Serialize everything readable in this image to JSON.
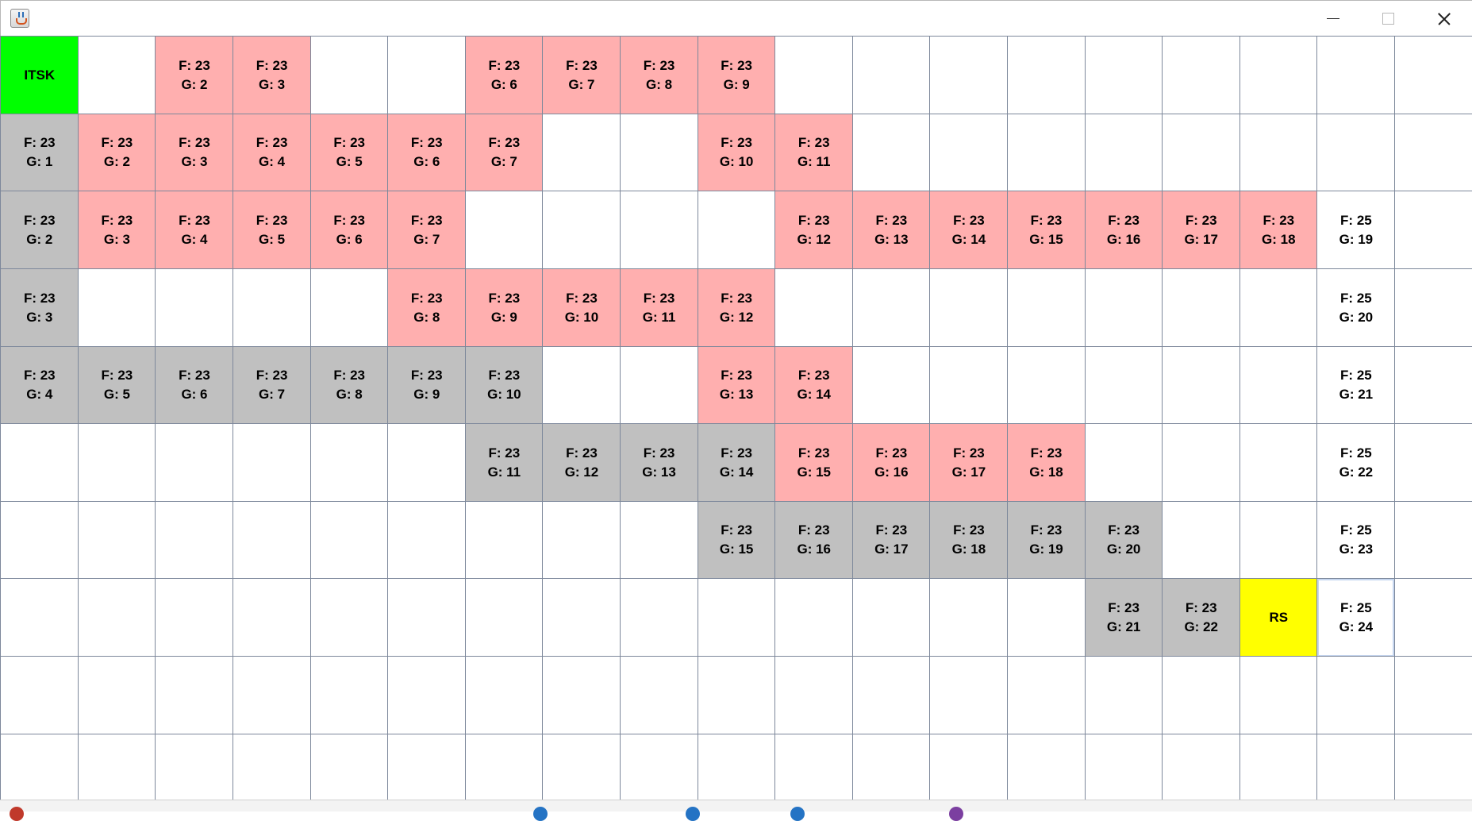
{
  "window": {
    "title": ""
  },
  "grid": {
    "rows": [
      [
        {
          "type": "start",
          "text": "ITSK"
        },
        {
          "type": "empty",
          "text": ""
        },
        {
          "type": "open",
          "text": "F: 23\nG: 2"
        },
        {
          "type": "open",
          "text": "F: 23\nG: 3"
        },
        {
          "type": "empty",
          "text": ""
        },
        {
          "type": "empty",
          "text": ""
        },
        {
          "type": "open",
          "text": "F: 23\nG: 6"
        },
        {
          "type": "open",
          "text": "F: 23\nG: 7"
        },
        {
          "type": "open",
          "text": "F: 23\nG: 8"
        },
        {
          "type": "open",
          "text": "F: 23\nG: 9"
        },
        {
          "type": "empty",
          "text": ""
        },
        {
          "type": "empty",
          "text": ""
        },
        {
          "type": "empty",
          "text": ""
        },
        {
          "type": "empty",
          "text": ""
        },
        {
          "type": "empty",
          "text": ""
        },
        {
          "type": "empty",
          "text": ""
        },
        {
          "type": "empty",
          "text": ""
        },
        {
          "type": "empty",
          "text": ""
        },
        {
          "type": "empty",
          "text": ""
        }
      ],
      [
        {
          "type": "closed",
          "text": "F: 23\nG: 1"
        },
        {
          "type": "open",
          "text": "F: 23\nG: 2"
        },
        {
          "type": "open",
          "text": "F: 23\nG: 3"
        },
        {
          "type": "open",
          "text": "F: 23\nG: 4"
        },
        {
          "type": "open",
          "text": "F: 23\nG: 5"
        },
        {
          "type": "open",
          "text": "F: 23\nG: 6"
        },
        {
          "type": "open",
          "text": "F: 23\nG: 7"
        },
        {
          "type": "empty",
          "text": ""
        },
        {
          "type": "empty",
          "text": ""
        },
        {
          "type": "open",
          "text": "F: 23\nG: 10"
        },
        {
          "type": "open",
          "text": "F: 23\nG: 11"
        },
        {
          "type": "empty",
          "text": ""
        },
        {
          "type": "empty",
          "text": ""
        },
        {
          "type": "empty",
          "text": ""
        },
        {
          "type": "empty",
          "text": ""
        },
        {
          "type": "empty",
          "text": ""
        },
        {
          "type": "empty",
          "text": ""
        },
        {
          "type": "empty",
          "text": ""
        },
        {
          "type": "empty",
          "text": ""
        }
      ],
      [
        {
          "type": "closed",
          "text": "F: 23\nG: 2"
        },
        {
          "type": "open",
          "text": "F: 23\nG: 3"
        },
        {
          "type": "open",
          "text": "F: 23\nG: 4"
        },
        {
          "type": "open",
          "text": "F: 23\nG: 5"
        },
        {
          "type": "open",
          "text": "F: 23\nG: 6"
        },
        {
          "type": "open",
          "text": "F: 23\nG: 7"
        },
        {
          "type": "empty",
          "text": ""
        },
        {
          "type": "empty",
          "text": ""
        },
        {
          "type": "empty",
          "text": ""
        },
        {
          "type": "empty",
          "text": ""
        },
        {
          "type": "open",
          "text": "F: 23\nG: 12"
        },
        {
          "type": "open",
          "text": "F: 23\nG: 13"
        },
        {
          "type": "open",
          "text": "F: 23\nG: 14"
        },
        {
          "type": "open",
          "text": "F: 23\nG: 15"
        },
        {
          "type": "open",
          "text": "F: 23\nG: 16"
        },
        {
          "type": "open",
          "text": "F: 23\nG: 17"
        },
        {
          "type": "open",
          "text": "F: 23\nG: 18"
        },
        {
          "type": "empty",
          "text": "F: 25\nG: 19"
        },
        {
          "type": "empty",
          "text": ""
        }
      ],
      [
        {
          "type": "closed",
          "text": "F: 23\nG: 3"
        },
        {
          "type": "empty",
          "text": ""
        },
        {
          "type": "empty",
          "text": ""
        },
        {
          "type": "empty",
          "text": ""
        },
        {
          "type": "empty",
          "text": ""
        },
        {
          "type": "open",
          "text": "F: 23\nG: 8"
        },
        {
          "type": "open",
          "text": "F: 23\nG: 9"
        },
        {
          "type": "open",
          "text": "F: 23\nG: 10"
        },
        {
          "type": "open",
          "text": "F: 23\nG: 11"
        },
        {
          "type": "open",
          "text": "F: 23\nG: 12"
        },
        {
          "type": "empty",
          "text": ""
        },
        {
          "type": "empty",
          "text": ""
        },
        {
          "type": "empty",
          "text": ""
        },
        {
          "type": "empty",
          "text": ""
        },
        {
          "type": "empty",
          "text": ""
        },
        {
          "type": "empty",
          "text": ""
        },
        {
          "type": "empty",
          "text": ""
        },
        {
          "type": "empty",
          "text": "F: 25\nG: 20"
        },
        {
          "type": "empty",
          "text": ""
        }
      ],
      [
        {
          "type": "closed",
          "text": "F: 23\nG: 4"
        },
        {
          "type": "closed",
          "text": "F: 23\nG: 5"
        },
        {
          "type": "closed",
          "text": "F: 23\nG: 6"
        },
        {
          "type": "closed",
          "text": "F: 23\nG: 7"
        },
        {
          "type": "closed",
          "text": "F: 23\nG: 8"
        },
        {
          "type": "closed",
          "text": "F: 23\nG: 9"
        },
        {
          "type": "closed",
          "text": "F: 23\nG: 10"
        },
        {
          "type": "empty",
          "text": ""
        },
        {
          "type": "empty",
          "text": ""
        },
        {
          "type": "open",
          "text": "F: 23\nG: 13"
        },
        {
          "type": "open",
          "text": "F: 23\nG: 14"
        },
        {
          "type": "empty",
          "text": ""
        },
        {
          "type": "empty",
          "text": ""
        },
        {
          "type": "empty",
          "text": ""
        },
        {
          "type": "empty",
          "text": ""
        },
        {
          "type": "empty",
          "text": ""
        },
        {
          "type": "empty",
          "text": ""
        },
        {
          "type": "empty",
          "text": "F: 25\nG: 21"
        },
        {
          "type": "empty",
          "text": ""
        }
      ],
      [
        {
          "type": "empty",
          "text": ""
        },
        {
          "type": "empty",
          "text": ""
        },
        {
          "type": "empty",
          "text": ""
        },
        {
          "type": "empty",
          "text": ""
        },
        {
          "type": "empty",
          "text": ""
        },
        {
          "type": "empty",
          "text": ""
        },
        {
          "type": "closed",
          "text": "F: 23\nG: 11"
        },
        {
          "type": "closed",
          "text": "F: 23\nG: 12"
        },
        {
          "type": "closed",
          "text": "F: 23\nG: 13"
        },
        {
          "type": "closed",
          "text": "F: 23\nG: 14"
        },
        {
          "type": "open",
          "text": "F: 23\nG: 15"
        },
        {
          "type": "open",
          "text": "F: 23\nG: 16"
        },
        {
          "type": "open",
          "text": "F: 23\nG: 17"
        },
        {
          "type": "open",
          "text": "F: 23\nG: 18"
        },
        {
          "type": "empty",
          "text": ""
        },
        {
          "type": "empty",
          "text": ""
        },
        {
          "type": "empty",
          "text": ""
        },
        {
          "type": "empty",
          "text": "F: 25\nG: 22"
        },
        {
          "type": "empty",
          "text": ""
        }
      ],
      [
        {
          "type": "empty",
          "text": ""
        },
        {
          "type": "empty",
          "text": ""
        },
        {
          "type": "empty",
          "text": ""
        },
        {
          "type": "empty",
          "text": ""
        },
        {
          "type": "empty",
          "text": ""
        },
        {
          "type": "empty",
          "text": ""
        },
        {
          "type": "empty",
          "text": ""
        },
        {
          "type": "empty",
          "text": ""
        },
        {
          "type": "empty",
          "text": ""
        },
        {
          "type": "closed",
          "text": "F: 23\nG: 15"
        },
        {
          "type": "closed",
          "text": "F: 23\nG: 16"
        },
        {
          "type": "closed",
          "text": "F: 23\nG: 17"
        },
        {
          "type": "closed",
          "text": "F: 23\nG: 18"
        },
        {
          "type": "closed",
          "text": "F: 23\nG: 19"
        },
        {
          "type": "closed",
          "text": "F: 23\nG: 20"
        },
        {
          "type": "empty",
          "text": ""
        },
        {
          "type": "empty",
          "text": ""
        },
        {
          "type": "empty",
          "text": "F: 25\nG: 23"
        },
        {
          "type": "empty",
          "text": ""
        }
      ],
      [
        {
          "type": "empty",
          "text": ""
        },
        {
          "type": "empty",
          "text": ""
        },
        {
          "type": "empty",
          "text": ""
        },
        {
          "type": "empty",
          "text": ""
        },
        {
          "type": "empty",
          "text": ""
        },
        {
          "type": "empty",
          "text": ""
        },
        {
          "type": "empty",
          "text": ""
        },
        {
          "type": "empty",
          "text": ""
        },
        {
          "type": "empty",
          "text": ""
        },
        {
          "type": "empty",
          "text": ""
        },
        {
          "type": "empty",
          "text": ""
        },
        {
          "type": "empty",
          "text": ""
        },
        {
          "type": "empty",
          "text": ""
        },
        {
          "type": "empty",
          "text": ""
        },
        {
          "type": "closed",
          "text": "F: 23\nG: 21"
        },
        {
          "type": "closed",
          "text": "F: 23\nG: 22"
        },
        {
          "type": "goal",
          "text": "RS"
        },
        {
          "type": "current",
          "text": "F: 25\nG: 24"
        },
        {
          "type": "empty",
          "text": ""
        }
      ],
      [
        {
          "type": "empty",
          "text": ""
        },
        {
          "type": "empty",
          "text": ""
        },
        {
          "type": "empty",
          "text": ""
        },
        {
          "type": "empty",
          "text": ""
        },
        {
          "type": "empty",
          "text": ""
        },
        {
          "type": "empty",
          "text": ""
        },
        {
          "type": "empty",
          "text": ""
        },
        {
          "type": "empty",
          "text": ""
        },
        {
          "type": "empty",
          "text": ""
        },
        {
          "type": "empty",
          "text": ""
        },
        {
          "type": "empty",
          "text": ""
        },
        {
          "type": "empty",
          "text": ""
        },
        {
          "type": "empty",
          "text": ""
        },
        {
          "type": "empty",
          "text": ""
        },
        {
          "type": "empty",
          "text": ""
        },
        {
          "type": "empty",
          "text": ""
        },
        {
          "type": "empty",
          "text": ""
        },
        {
          "type": "empty",
          "text": ""
        },
        {
          "type": "empty",
          "text": ""
        }
      ],
      [
        {
          "type": "empty",
          "text": ""
        },
        {
          "type": "empty",
          "text": ""
        },
        {
          "type": "empty",
          "text": ""
        },
        {
          "type": "empty",
          "text": ""
        },
        {
          "type": "empty",
          "text": ""
        },
        {
          "type": "empty",
          "text": ""
        },
        {
          "type": "empty",
          "text": ""
        },
        {
          "type": "empty",
          "text": ""
        },
        {
          "type": "empty",
          "text": ""
        },
        {
          "type": "empty",
          "text": ""
        },
        {
          "type": "empty",
          "text": ""
        },
        {
          "type": "empty",
          "text": ""
        },
        {
          "type": "empty",
          "text": ""
        },
        {
          "type": "empty",
          "text": ""
        },
        {
          "type": "empty",
          "text": ""
        },
        {
          "type": "empty",
          "text": ""
        },
        {
          "type": "empty",
          "text": ""
        },
        {
          "type": "empty",
          "text": ""
        },
        {
          "type": "empty",
          "text": ""
        }
      ]
    ]
  },
  "colors": {
    "start": "#00ff00",
    "goal": "#ffff00",
    "open": "#ffafaf",
    "closed": "#c0c0c0",
    "empty": "#ffffff",
    "grid_line": "#7d889b"
  },
  "icons": {
    "app": "java-cup-icon",
    "minimize": "minimize-icon",
    "maximize": "maximize-icon",
    "close": "close-icon"
  },
  "taskbar": {
    "indicators": [
      {
        "name": "taskbar-app-red",
        "color": "#c0392b"
      },
      {
        "name": "taskbar-app-blue-1",
        "color": "#2473c4"
      },
      {
        "name": "taskbar-app-blue-2",
        "color": "#2473c4"
      },
      {
        "name": "taskbar-app-blue-3",
        "color": "#2473c4"
      },
      {
        "name": "taskbar-app-purple",
        "color": "#7b3fa0"
      }
    ]
  }
}
